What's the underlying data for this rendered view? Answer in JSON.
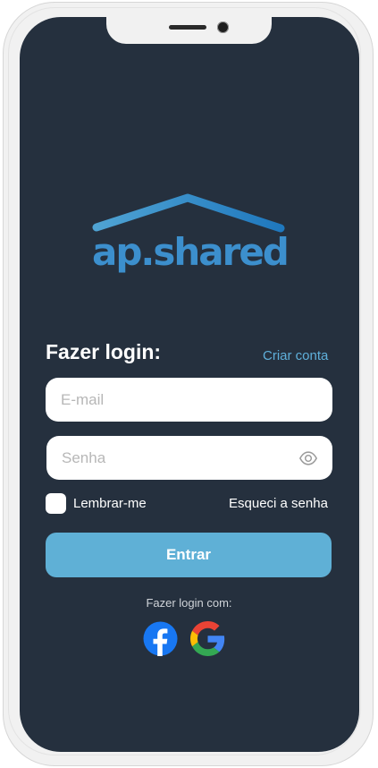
{
  "brand": {
    "logo_text": "ap.shared",
    "logo_color": "#3c8fcd",
    "icon": "house-roof-icon"
  },
  "login": {
    "title": "Fazer login:",
    "create_account": "Criar conta",
    "email_placeholder": "E-mail",
    "password_placeholder": "Senha",
    "remember_me": "Lembrar-me",
    "forgot_password": "Esqueci a senha",
    "submit": "Entrar"
  },
  "social": {
    "label": "Fazer login com:",
    "providers": [
      "facebook-icon",
      "google-icon"
    ]
  },
  "colors": {
    "background": "#25303e",
    "accent": "#5fb0d6",
    "link": "#5fb0db",
    "facebook": "#1877f2"
  }
}
